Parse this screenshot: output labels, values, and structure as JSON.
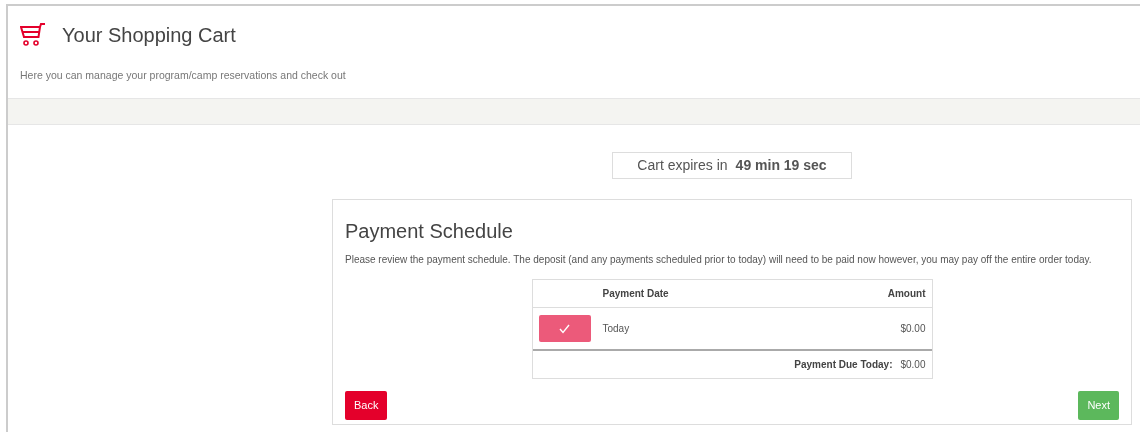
{
  "header": {
    "title": "Your Shopping Cart",
    "subtitle": "Here you can manage your program/camp reservations and check out"
  },
  "timer": {
    "label": "Cart expires in",
    "value": "49 min 19 sec"
  },
  "schedule": {
    "title": "Payment Schedule",
    "description": "Please review the payment schedule. The deposit (and any payments scheduled prior to today) will need to be paid now however, you may pay off the entire order today.",
    "columns": [
      "Payment Date",
      "Amount"
    ],
    "rows": [
      {
        "date": "Today",
        "amount": "$0.00",
        "selected": true
      }
    ],
    "total_label": "Payment Due Today:",
    "total_value": "$0.00"
  },
  "buttons": {
    "back": "Back",
    "next": "Next"
  }
}
